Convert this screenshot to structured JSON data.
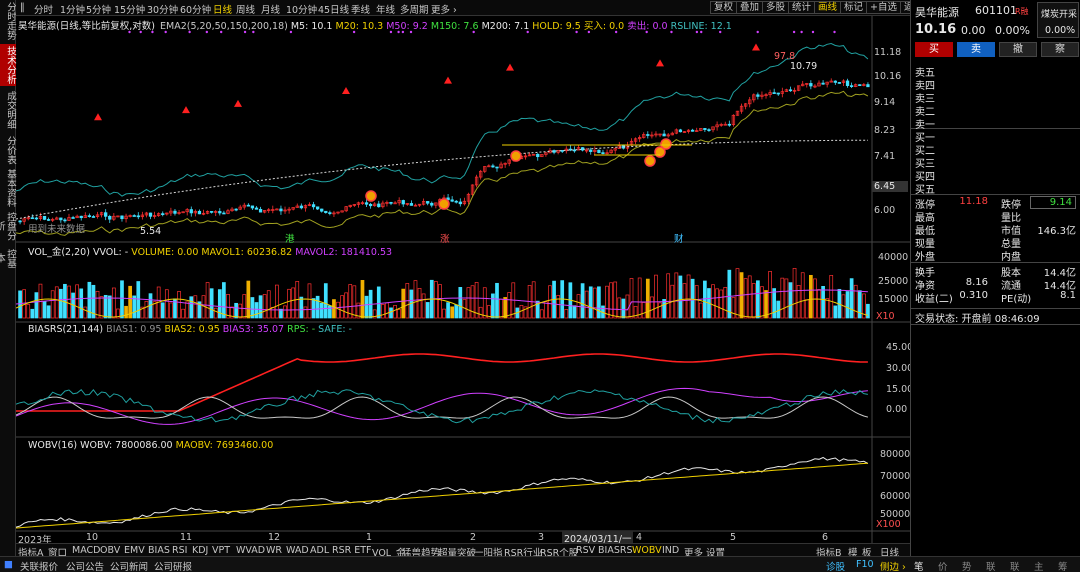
{
  "left_tabs": [
    "分时走势",
    "技术分析",
    "成交明细",
    "分价表",
    "基本资料",
    "控盘分析",
    "控基本"
  ],
  "periods": [
    "分时",
    "1分钟",
    "5分钟",
    "15分钟",
    "30分钟",
    "60分钟",
    "日线",
    "周线",
    "月线",
    "10分钟",
    "45日线",
    "季线",
    "年线",
    "多周期",
    "更多 ›"
  ],
  "period_active": "日线",
  "top_buttons": [
    "复权",
    "叠加",
    "多股",
    "统计",
    "画线",
    "标记"
  ],
  "top_buttons_active": "画线",
  "top_right": {
    "self_select": "+自选",
    "return": "返回"
  },
  "info_line": {
    "stock": "昊华能源",
    "mode": "(日线,等比前复权,对数)",
    "ema_label": "EMA2(5,20,50,150,200,18)",
    "m5": "M5: 10.1",
    "m20": "M20: 10.3",
    "m50": "M50: 9.2",
    "m150": "M150: 7.6",
    "m200": "M200: 7.1",
    "hold": "HOLD: 9.5",
    "buy": "买入: 0.0",
    "sell": "卖出: 0.0",
    "rsline": "RSLINE: 12.1"
  },
  "price_axis": [
    "11.18",
    "10.16",
    "9.14",
    "8.23",
    "7.41",
    "6.45",
    "6.00"
  ],
  "price_tag": "6.45",
  "annotations": {
    "high": "97.8",
    "high2": "10.79",
    "low": "5.54",
    "note": "用到未来数据"
  },
  "event_tags": [
    "港",
    "涨",
    "财"
  ],
  "vol_line": {
    "label": "VOL_金(2,20)",
    "vvol": "VVOL: -",
    "volume": "VOLUME: 0.00",
    "mavol1": "MAVOL1: 60236.82",
    "mavol2": "MAVOL2: 181410.53"
  },
  "vol_axis": [
    "40000",
    "25000",
    "15000",
    "X10"
  ],
  "bias_line": {
    "label": "BIASRS(21,144)",
    "bias1": "BIAS1: 0.95",
    "bias2": "BIAS2: 0.95",
    "bias3": "BIAS3: 35.07",
    "rps": "RPS: -",
    "safe": "SAFE: -"
  },
  "bias_axis": [
    "45.00",
    "30.00",
    "15.00",
    "0.00"
  ],
  "wobv_line": {
    "label": "WOBV(16)",
    "wobv": "WOBV: 7800086.00",
    "maobv": "MAOBV: 7693460.00"
  },
  "wobv_axis": [
    "80000",
    "70000",
    "60000",
    "50000",
    "X100"
  ],
  "x_axis": [
    "2023年",
    "10",
    "11",
    "12",
    "1",
    "2",
    "3",
    "2024/03/11/一",
    "4",
    "5",
    "6"
  ],
  "bottom_tabs": [
    "指标A",
    "窗口",
    "MACD",
    "OBV",
    "EMV",
    "BIAS",
    "RSI",
    "KDJ",
    "VPT",
    "WVAD",
    "WR",
    "WAD",
    "ADL",
    "RSR ETF",
    "VOL_金",
    "猛兽趋势",
    "超量突破",
    "一阳指",
    "RSR行业",
    "RSR个股",
    "RSV",
    "BIASRS",
    "WOBV",
    "IND",
    "更多",
    "设置"
  ],
  "bottom_active": "WOBV",
  "bottom_right": [
    "指标B",
    "模",
    "板",
    "日线"
  ],
  "status_items": [
    "关联报价",
    "公司公告",
    "公司新闻",
    "公司研报"
  ],
  "status_right": [
    "诊股",
    "F10",
    "侧边 ›"
  ],
  "right_panel": {
    "name": "昊华能源",
    "code": "601101",
    "rz": "R融",
    "sector": "煤炭开采",
    "sector_pct": "0.00%",
    "price": "10.16",
    "change": "0.00",
    "pct": "0.00%",
    "buttons": [
      "买",
      "卖",
      "撤",
      "察"
    ],
    "sell_levels": [
      "卖五",
      "卖四",
      "卖三",
      "卖二",
      "卖一"
    ],
    "buy_levels": [
      "买一",
      "买二",
      "买三",
      "买四",
      "买五"
    ],
    "stats": [
      {
        "l1": "涨停",
        "v1": "11.18",
        "l2": "跌停",
        "v2": "9.14"
      },
      {
        "l1": "最高",
        "v1": "",
        "l2": "量比",
        "v2": ""
      },
      {
        "l1": "最低",
        "v1": "",
        "l2": "市值",
        "v2": "146.3亿"
      },
      {
        "l1": "现量",
        "v1": "",
        "l2": "总量",
        "v2": ""
      },
      {
        "l1": "外盘",
        "v1": "",
        "l2": "内盘",
        "v2": ""
      }
    ],
    "stats2": [
      {
        "l1": "换手",
        "v1": "",
        "l2": "股本",
        "v2": "14.4亿"
      },
      {
        "l1": "净资",
        "v1": "8.16",
        "l2": "流通",
        "v2": "14.4亿"
      },
      {
        "l1": "收益(二)",
        "v1": "0.310",
        "l2": "PE(动)",
        "v2": "8.1"
      }
    ],
    "trade_status": "交易状态: 开盘前 08:46:09",
    "bottom_tabs": [
      "笔",
      "价",
      "势",
      "联",
      "联",
      "主",
      "筹"
    ]
  },
  "colors": {
    "up": "#ff3030",
    "down": "#40e0ff",
    "gold": "#f0d000",
    "purple": "#d040ff",
    "accent": "#b00000"
  }
}
